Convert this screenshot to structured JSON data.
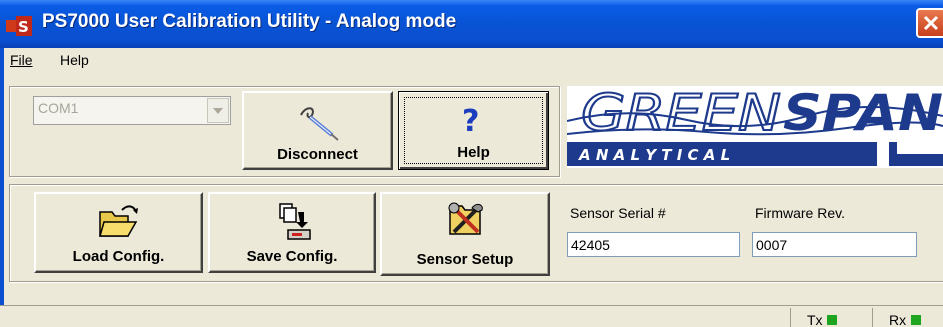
{
  "window": {
    "title": "PS7000 User Calibration Utility - Analog mode",
    "icon": "app-logo-icon"
  },
  "menu": {
    "items": [
      {
        "label": "File",
        "mnemonic": "F"
      },
      {
        "label": "Help",
        "mnemonic": "H"
      }
    ]
  },
  "connection": {
    "port": {
      "value": "COM1"
    },
    "disconnect_label": "Disconnect",
    "help_label": "Help"
  },
  "logo": {
    "line1_a": "GREEN",
    "line1_b": "SPAN",
    "line2": "A N A L Y T I C A L"
  },
  "config": {
    "load_label": "Load Config.",
    "save_label": "Save Config.",
    "setup_label": "Sensor Setup"
  },
  "sensor": {
    "serial_label": "Sensor Serial #",
    "serial_value": "42405",
    "firmware_label": "Firmware Rev.",
    "firmware_value": "0007"
  },
  "status": {
    "tx_label": "Tx",
    "rx_label": "Rx",
    "led_color": "#1fa51f"
  },
  "colors": {
    "titlebar": "#0853d4",
    "face": "#ece9d8",
    "logo_blue": "#1e3a8c"
  }
}
